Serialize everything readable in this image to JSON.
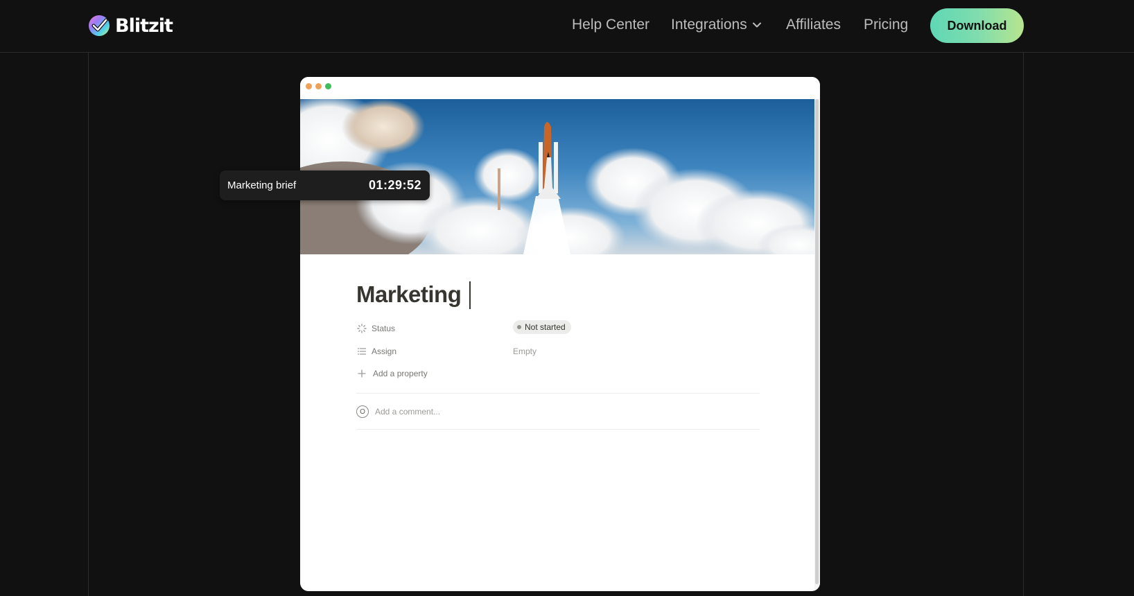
{
  "brand": {
    "name": "Blitzit",
    "logo_icon": "check-circle-gradient-icon",
    "colors": {
      "background": "#111111",
      "cta_gradient_start": "#5fd7b5",
      "cta_gradient_end": "#b7e58f"
    }
  },
  "nav": {
    "items": [
      {
        "label": "Help Center"
      },
      {
        "label": "Integrations",
        "icon": "chevron-down-icon"
      },
      {
        "label": "Affiliates"
      },
      {
        "label": "Pricing"
      }
    ],
    "cta_label": "Download"
  },
  "window": {
    "traffic_lights": [
      "#f0a057",
      "#f0a057",
      "#3fbf5c"
    ],
    "cover_image": "space-shuttle-launch-photo"
  },
  "page": {
    "title": "Marketing",
    "properties": [
      {
        "icon": "status-spinner-icon",
        "label": "Status",
        "value": "Not started"
      },
      {
        "icon": "list-icon",
        "label": "Assign",
        "value": "Empty"
      }
    ],
    "add_property_label": "Add a property",
    "comment_placeholder": "Add a comment...",
    "comment_avatar_letter": "O"
  },
  "timer": {
    "task_label": "Marketing brief",
    "elapsed": "01:29:52"
  }
}
